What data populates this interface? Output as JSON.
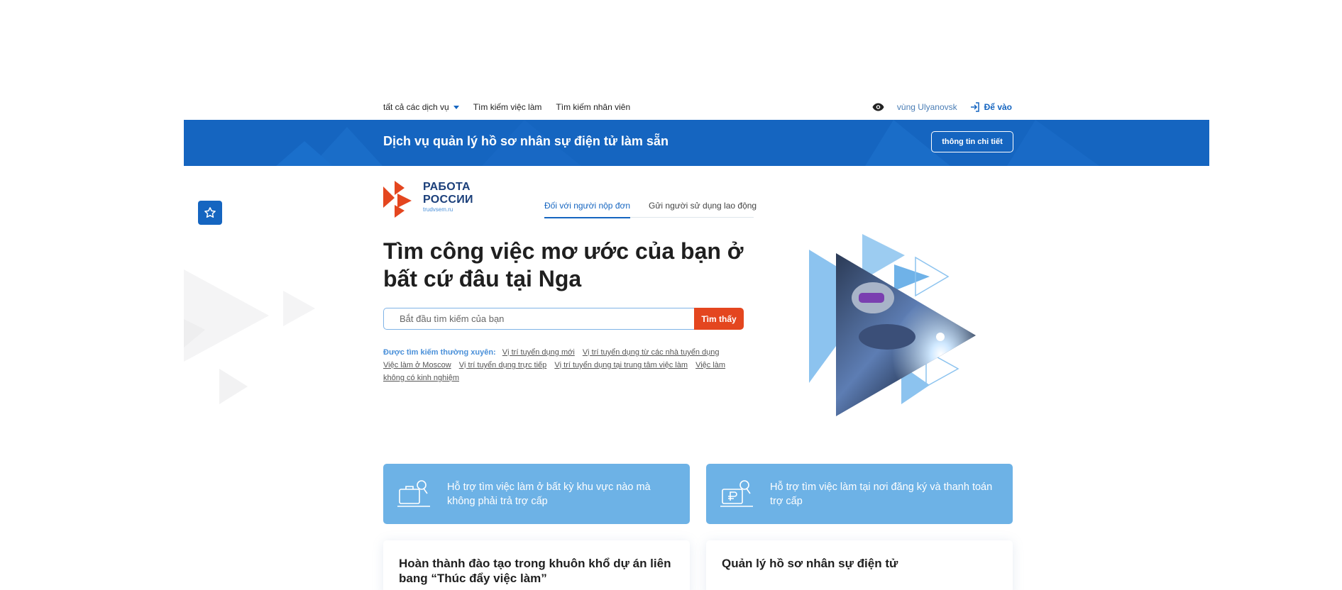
{
  "topnav": {
    "services_label": "tất cả các dịch vụ",
    "find_job_label": "Tìm kiếm việc làm",
    "find_staff_label": "Tìm kiếm nhân viên",
    "region_label": "vùng Ulyanovsk",
    "login_label": "Để vào"
  },
  "banner": {
    "title": "Dịch vụ quản lý hồ sơ nhân sự điện tử làm sẵn",
    "details_label": "thông tin chi tiết"
  },
  "logo": {
    "line1": "РАБОТА",
    "line2": "РОССИИ",
    "domain": "trudvsem.ru"
  },
  "tabs": [
    {
      "label": "Đối với người nộp đơn"
    },
    {
      "label": "Gửi người sử dụng lao động"
    }
  ],
  "hero": {
    "title": "Tìm công việc mơ ước của bạn ở bất cứ đâu tại Nga",
    "search_placeholder": "Bắt đầu tìm kiếm của bạn",
    "search_button": "Tìm thấy"
  },
  "frequent": {
    "label": "Được tìm kiếm thường xuyên:",
    "links": [
      "Vị trí tuyển dụng mới",
      "Vị trí tuyển dụng từ các nhà tuyển dụng",
      "Việc làm ở Moscow",
      "Vị trí tuyển dụng trực tiếp",
      "Vị trí tuyển dụng tại trung tâm việc làm",
      "Việc làm không có kinh nghiệm"
    ]
  },
  "cards": {
    "blue": [
      {
        "text": "Hỗ trợ tìm việc làm ở bất kỳ khu vực nào mà không phải trả trợ cấp",
        "icon": "briefcase-search-icon"
      },
      {
        "text": "Hỗ trợ tìm việc làm tại nơi đăng ký và thanh toán trợ cấp",
        "icon": "ruble-search-icon"
      }
    ],
    "white": [
      {
        "text": "Hoàn thành đào tạo trong khuôn khổ dự án liên bang “Thúc đẩy việc làm”"
      },
      {
        "text": "Quản lý hồ sơ nhân sự điện tử"
      }
    ]
  },
  "colors": {
    "brand_blue": "#1565c0",
    "accent_orange": "#e4461f",
    "card_blue": "#6db2e6"
  }
}
